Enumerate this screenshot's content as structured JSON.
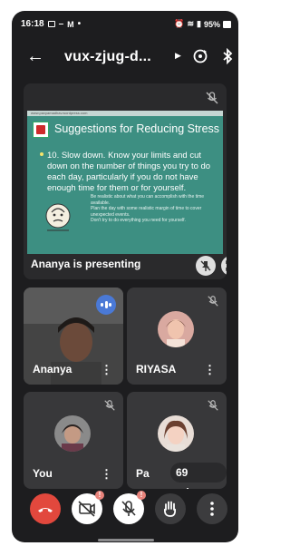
{
  "status_bar": {
    "time": "16:18",
    "battery": "95%",
    "icons": [
      "gallery-icon",
      "minus-icon",
      "gmail-icon",
      "dot-icon",
      "alarm-icon",
      "wifi-icon",
      "signal-icon",
      "battery-icon"
    ]
  },
  "top_bar": {
    "title": "vux-zjug-d...",
    "icons": [
      "back-arrow-icon",
      "caret-right-icon",
      "camera-flip-icon",
      "bluetooth-icon"
    ]
  },
  "presentation": {
    "label": "Ananya is presenting",
    "slide": {
      "header_strip": "www.pavyamadhav.wordpress.com",
      "title": "Suggestions for Reducing Stress",
      "main_text": "10. Slow down. Know your limits and cut down on the number of things you try to do each day, particularly if you do not have enough time for them or for yourself.",
      "sub_points": [
        "Be realistic about what you can accomplish with the time available.",
        "Plan the day with some realistic margin of time to cover unexpected events.",
        "Don't try to do everything you need for yourself."
      ]
    }
  },
  "participants": [
    {
      "name": "Ananya",
      "state": "speaking",
      "has_video": true
    },
    {
      "name": "RIYASA",
      "state": "muted",
      "has_video": false
    },
    {
      "name": "You",
      "state": "muted",
      "has_video": false
    },
    {
      "name": "Pa",
      "state": "muted",
      "has_video": false,
      "overlay": "69 others"
    }
  ],
  "controls": {
    "buttons": [
      "end-call-button",
      "camera-off-button",
      "mic-off-button",
      "raise-hand-button",
      "more-options-button"
    ],
    "camera_badge": "!",
    "mic_badge": "!"
  },
  "colors": {
    "background": "#1d1d1f",
    "tile": "#38383a",
    "end_call": "#e2483d",
    "speaking": "#4a79d6",
    "slide": "#3d8f82"
  }
}
